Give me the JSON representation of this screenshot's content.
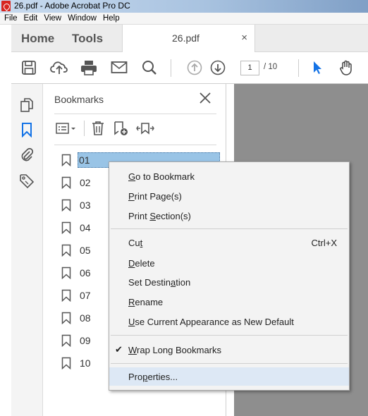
{
  "window": {
    "title": "26.pdf - Adobe Acrobat Pro DC"
  },
  "menubar": {
    "items": [
      "File",
      "Edit",
      "View",
      "Window",
      "Help"
    ]
  },
  "tabs": {
    "home": "Home",
    "tools": "Tools",
    "document": "26.pdf",
    "close": "×"
  },
  "toolbar": {
    "icons": [
      "save-icon",
      "upload-icon",
      "print-icon",
      "email-icon",
      "search-icon",
      "prev-page-icon",
      "next-page-icon",
      "select-pointer-icon",
      "hand-tool-icon"
    ],
    "page_current": "1",
    "page_total": "/ 10",
    "accent": "#1473e6"
  },
  "rail": {
    "icons": [
      "pages-icon",
      "bookmark-icon",
      "attachment-icon",
      "tag-icon"
    ]
  },
  "bookmarks_panel": {
    "title": "Bookmarks",
    "tools": [
      "options-menu-icon",
      "delete-icon",
      "new-bookmark-icon",
      "expand-bookmark-icon"
    ],
    "items": [
      "01",
      "02",
      "03",
      "04",
      "05",
      "06",
      "07",
      "08",
      "09",
      "10"
    ],
    "selected_index": 0,
    "selected_color": "#99c4e6"
  },
  "context_menu": {
    "items": [
      {
        "pre": "",
        "u": "G",
        "post": "o to Bookmark"
      },
      {
        "pre": "",
        "u": "P",
        "post": "rint Page(s)"
      },
      {
        "pre": "Print ",
        "u": "S",
        "post": "ection(s)"
      },
      {
        "pre": "Cu",
        "u": "t",
        "post": "",
        "shortcut": "Ctrl+X"
      },
      {
        "pre": "",
        "u": "D",
        "post": "elete"
      },
      {
        "pre": "Set Destin",
        "u": "a",
        "post": "tion"
      },
      {
        "pre": "",
        "u": "R",
        "post": "ename"
      },
      {
        "pre": "",
        "u": "U",
        "post": "se Current Appearance as New Default"
      },
      {
        "pre": "",
        "u": "W",
        "post": "rap Long Bookmarks",
        "checked": "✔"
      },
      {
        "pre": "Pro",
        "u": "p",
        "post": "erties..."
      }
    ],
    "hover_index": 9
  }
}
